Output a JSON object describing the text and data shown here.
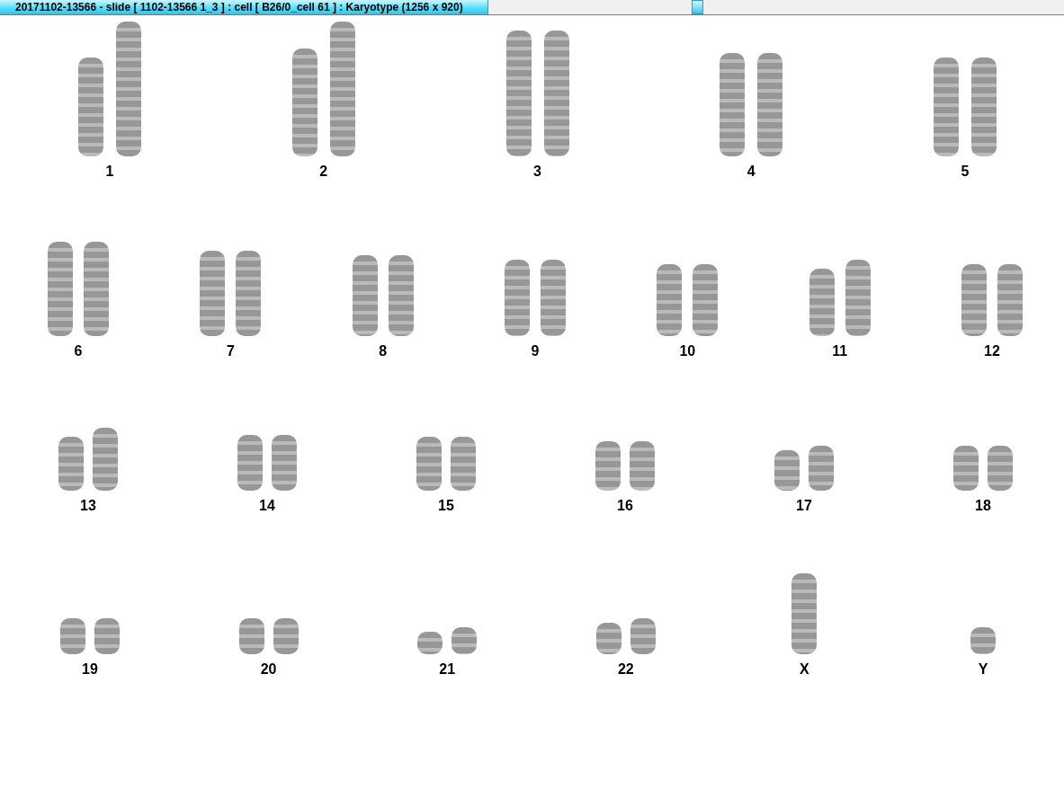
{
  "window": {
    "title": "20171102-13566 - slide [ 1102-13566 1_3 ] : cell [ B26/0_cell 61 ] : Karyotype  (1256 x 920)"
  },
  "karyotype": {
    "rows": [
      {
        "items": [
          {
            "label": "1"
          },
          {
            "label": "2"
          },
          {
            "label": "3"
          },
          {
            "label": "4"
          },
          {
            "label": "5"
          }
        ]
      },
      {
        "items": [
          {
            "label": "6"
          },
          {
            "label": "7"
          },
          {
            "label": "8"
          },
          {
            "label": "9"
          },
          {
            "label": "10"
          },
          {
            "label": "11"
          },
          {
            "label": "12"
          }
        ]
      },
      {
        "items": [
          {
            "label": "13"
          },
          {
            "label": "14"
          },
          {
            "label": "15"
          },
          {
            "label": "16"
          },
          {
            "label": "17"
          },
          {
            "label": "18"
          }
        ]
      },
      {
        "items": [
          {
            "label": "19"
          },
          {
            "label": "20"
          },
          {
            "label": "21"
          },
          {
            "label": "22"
          },
          {
            "label": "X"
          },
          {
            "label": "Y"
          }
        ]
      }
    ]
  }
}
